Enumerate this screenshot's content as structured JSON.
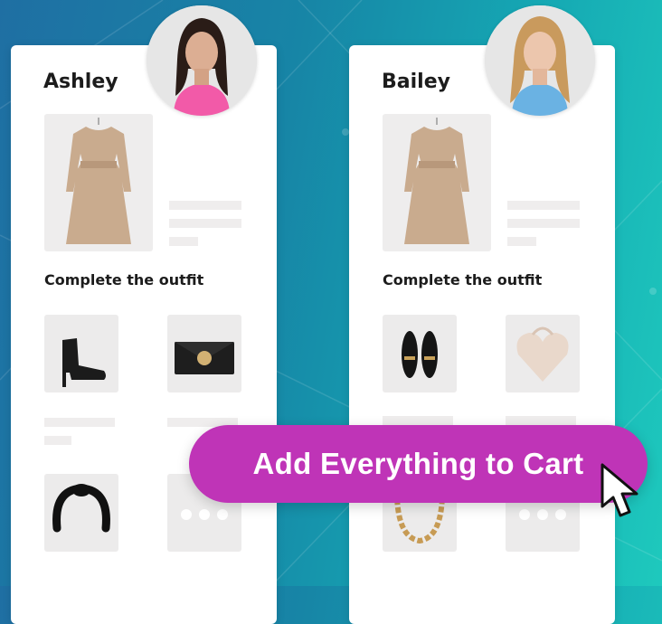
{
  "colors": {
    "accent": "#bf34b7",
    "card": "#ffffff",
    "placeholder": "#efeded"
  },
  "cards": [
    {
      "name": "Ashley",
      "subtitle": "Complete the outfit",
      "avatar_shirt": "#f25aa8",
      "avatar_hair": "#2a1c17",
      "items": [
        "ankle-boot-icon",
        "clutch-bag-icon",
        "headband-icon",
        "more-dots-icon"
      ]
    },
    {
      "name": "Bailey",
      "subtitle": "Complete the outfit",
      "avatar_shirt": "#6ab2e3",
      "avatar_hair": "#c99a5d",
      "items": [
        "loafer-shoes-icon",
        "heart-bag-icon",
        "chain-necklace-icon",
        "more-dots-icon"
      ]
    }
  ],
  "cta": {
    "label": "Add Everything to Cart"
  }
}
